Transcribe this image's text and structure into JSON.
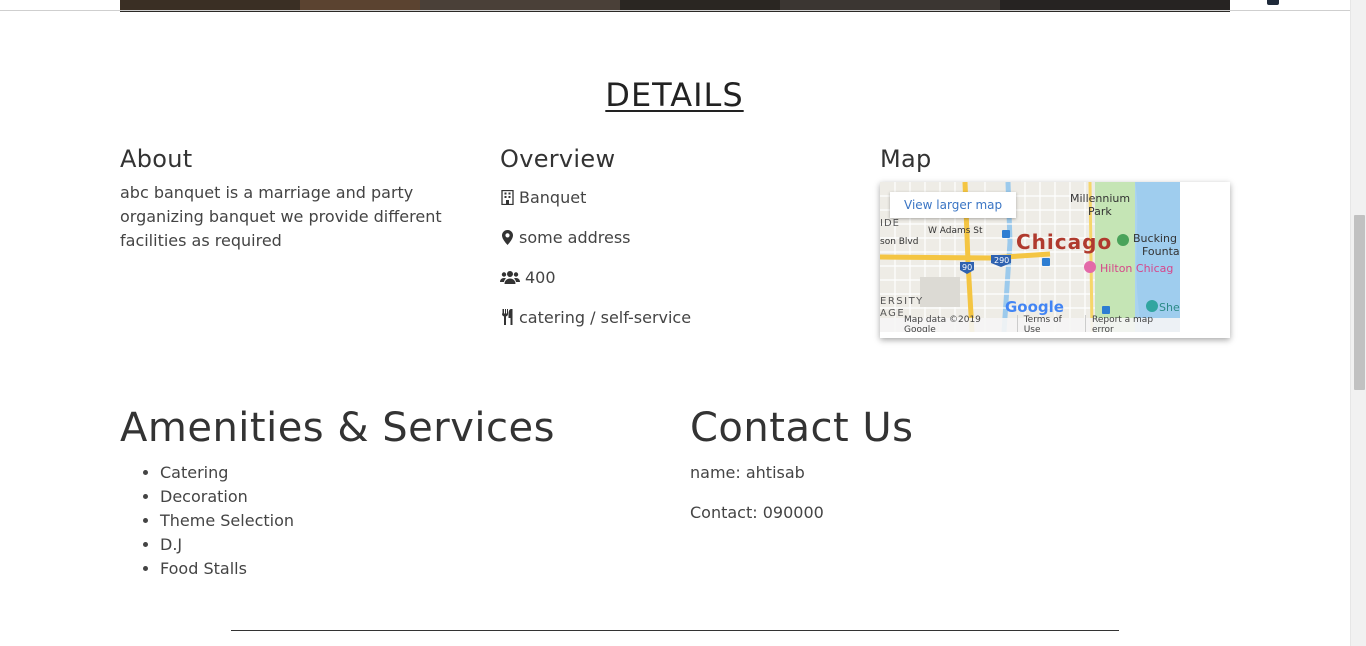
{
  "details": {
    "title": "DETAILS"
  },
  "about": {
    "heading": "About",
    "text": "abc banquet is a marriage and party organizing banquet we provide different facilities as required"
  },
  "overview": {
    "heading": "Overview",
    "items": [
      {
        "icon": "building-icon",
        "text": "Banquet"
      },
      {
        "icon": "map-marker-icon",
        "text": "some address"
      },
      {
        "icon": "users-icon",
        "text": "400"
      },
      {
        "icon": "utensils-icon",
        "text": "catering / self-service"
      }
    ]
  },
  "map": {
    "heading": "Map",
    "view_larger": "View larger map",
    "city": "Chicago",
    "labels": {
      "millennium": "Millennium",
      "park": "Park",
      "buckingham": "Bucking",
      "fountain": "Founta",
      "hilton": "Hilton Chicag",
      "adams": "W Adams St",
      "blvd": "son Blvd",
      "ide": "IDE",
      "ersity": "ERSITY",
      "age": "AGE",
      "shed": "She",
      "i90": "90",
      "i290": "290",
      "google": "Google"
    },
    "footer": [
      "Map data ©2019 Google",
      "Terms of Use",
      "Report a map error"
    ]
  },
  "amenities": {
    "heading": "Amenities & Services",
    "items": [
      "Catering",
      "Decoration",
      "Theme Selection",
      "D.J",
      "Food Stalls"
    ]
  },
  "contact": {
    "heading": "Contact Us",
    "name": "name: ahtisab",
    "phone": "Contact: 090000"
  }
}
